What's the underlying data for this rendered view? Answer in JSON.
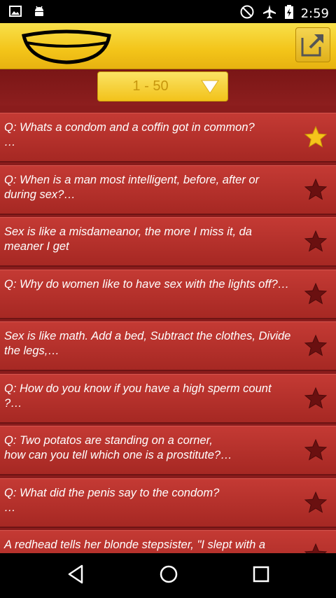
{
  "status_bar": {
    "time": "2:59",
    "icons": [
      "image-icon",
      "android-icon",
      "do-not-disturb-icon",
      "airplane-mode-icon",
      "battery-charging-icon"
    ]
  },
  "app_bar": {
    "logo": "smile-logo-icon",
    "share_icon": "open-external-icon"
  },
  "range_selector": {
    "label": "1 - 50"
  },
  "jokes": [
    {
      "text": "Q: Whats a condom and a coffin got in common?\n…",
      "favorite": true
    },
    {
      "text": "Q: When is a man most intelligent, before, after or during sex?…",
      "favorite": false
    },
    {
      "text": "Sex is like a misdameanor, the more I miss it, da meaner I get",
      "favorite": false
    },
    {
      "text": "Q: Why do women like to have sex with the lights off?…",
      "favorite": false
    },
    {
      "text": "Sex is like math. Add a bed, Subtract the clothes, Divide the legs,…",
      "favorite": false
    },
    {
      "text": "Q: How do you know if you have a high sperm count ?…",
      "favorite": false
    },
    {
      "text": "Q: Two potatos are standing on a corner,\nhow can you tell which one is a prostitute?…",
      "favorite": false
    },
    {
      "text": "Q: What did the penis say to the condom?\n…",
      "favorite": false
    },
    {
      "text": "A redhead tells her blonde stepsister, \"I slept with a",
      "favorite": false
    }
  ],
  "colors": {
    "accent_yellow": "#f3c419",
    "list_red": "#b22f2a",
    "star_active": "#f6c31b",
    "star_inactive": "#6a1010"
  },
  "nav_bar": {
    "icons": [
      "back-icon",
      "home-icon",
      "recents-icon"
    ]
  }
}
